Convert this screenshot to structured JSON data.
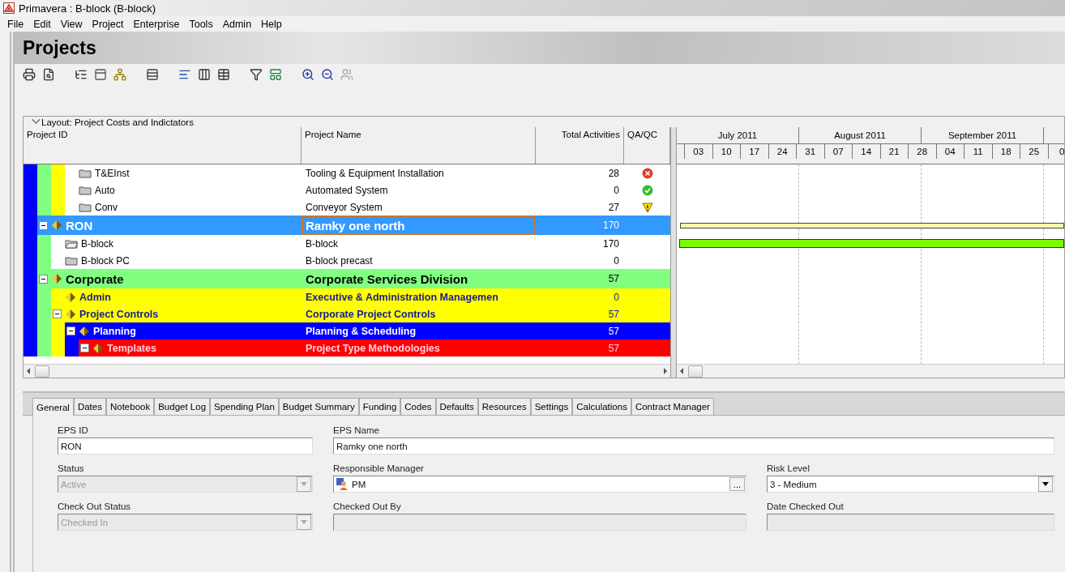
{
  "window": {
    "title": "Primavera : B-block (B-block)"
  },
  "menu": [
    "File",
    "Edit",
    "View",
    "Project",
    "Enterprise",
    "Tools",
    "Admin",
    "Help"
  ],
  "page_title": "Projects",
  "layout": {
    "label": "Layout: Project Costs and Indictators",
    "expanded": true
  },
  "table": {
    "columns": [
      "Project ID",
      "Project Name",
      "Total Activities",
      "QA/QC"
    ],
    "rows": [
      {
        "kind": "project",
        "id": "T&EInst",
        "name": "Tooling & Equipment Installation",
        "total": "28",
        "qaqc": {
          "kind": "error"
        },
        "opened": false,
        "bands": [
          {
            "color": "#0000ff"
          },
          {
            "color": "#80ff80"
          },
          {
            "color": "#ffff00"
          }
        ],
        "selected": false,
        "focused": false
      },
      {
        "kind": "project",
        "id": "Auto",
        "name": "Automated System",
        "total": "0",
        "qaqc": {
          "kind": "ok"
        },
        "opened": false,
        "bands": [
          {
            "color": "#0000ff"
          },
          {
            "color": "#80ff80"
          },
          {
            "color": "#ffff00"
          }
        ],
        "selected": false,
        "focused": false
      },
      {
        "kind": "project",
        "id": "Conv",
        "name": "Conveyor System",
        "total": "27",
        "qaqc": {
          "kind": "warning"
        },
        "opened": false,
        "bands": [
          {
            "color": "#0000ff"
          },
          {
            "color": "#80ff80"
          },
          {
            "color": "#ffff00"
          }
        ],
        "selected": false,
        "focused": false
      },
      {
        "kind": "eps",
        "id": "RON",
        "name": "Ramky one north",
        "total": "170",
        "color": "#80ff80",
        "bands": [
          {
            "color": "#0000ff"
          }
        ],
        "selected": true,
        "focused": true,
        "expanded": true,
        "bar": {
          "kind": "summary"
        },
        "children": [
          {
            "kind": "project",
            "id": "B-block",
            "name": "B-block",
            "total": "170",
            "opened": true,
            "selected": false,
            "focused": false,
            "bar": {
              "kind": "activity"
            }
          },
          {
            "kind": "project",
            "id": "B-block PC",
            "name": "B-block precast",
            "total": "0",
            "opened": false,
            "selected": false,
            "focused": false
          }
        ]
      },
      {
        "kind": "eps",
        "id": "Corporate",
        "name": "Corporate Services Division",
        "total": "57",
        "color": "#80ff80",
        "bands": [
          {
            "color": "#0000ff"
          }
        ],
        "selected": false,
        "focused": false,
        "expanded": true,
        "children": [
          {
            "kind": "eps",
            "id": "Admin",
            "name": "Executive & Administration Managemen",
            "total": "0",
            "color": "#ffff00",
            "selected": false,
            "focused": false
          },
          {
            "kind": "eps",
            "id": "Project Controls",
            "name": "Corporate Project Controls",
            "total": "57",
            "color": "#ffff00",
            "selected": false,
            "focused": false,
            "expanded": true,
            "children": [
              {
                "kind": "eps",
                "id": "Planning",
                "name": "Planning & Scheduling",
                "total": "57",
                "color": "#0000ff",
                "selected": false,
                "focused": false,
                "expanded": true,
                "children": [
                  {
                    "kind": "eps",
                    "id": "Templates",
                    "name": "Project Type Methodologies",
                    "total": "57",
                    "color": "#ff0000",
                    "selected": false,
                    "focused": false,
                    "expanded": true
                  }
                ]
              }
            ]
          }
        ]
      }
    ]
  },
  "gantt": {
    "months": [
      "July 2011",
      "August 2011",
      "September 2011"
    ],
    "weeks": [
      "03",
      "10",
      "17",
      "24",
      "31",
      "07",
      "14",
      "21",
      "28",
      "04",
      "11",
      "18",
      "25",
      "0"
    ]
  },
  "tabs": [
    {
      "label": "General",
      "selected": true
    },
    {
      "label": "Dates",
      "selected": false
    },
    {
      "label": "Notebook",
      "selected": false
    },
    {
      "label": "Budget Log",
      "selected": false
    },
    {
      "label": "Spending Plan",
      "selected": false
    },
    {
      "label": "Budget Summary",
      "selected": false
    },
    {
      "label": "Funding",
      "selected": false
    },
    {
      "label": "Codes",
      "selected": false
    },
    {
      "label": "Defaults",
      "selected": false
    },
    {
      "label": "Resources",
      "selected": false
    },
    {
      "label": "Settings",
      "selected": false
    },
    {
      "label": "Calculations",
      "selected": false
    },
    {
      "label": "Contract Manager",
      "selected": false
    }
  ],
  "form_rows": [
    [
      {
        "label": "EPS ID",
        "value": "RON",
        "kind": "text",
        "disabled": false
      },
      {
        "label": "EPS Name",
        "value": "Ramky one north",
        "kind": "text",
        "disabled": false
      }
    ],
    [
      {
        "label": "Status",
        "value": "Active",
        "kind": "select",
        "disabled": true
      },
      {
        "label": "Responsible Manager",
        "value": "PM",
        "kind": "lookup",
        "button": "...",
        "disabled": false
      },
      {
        "label": "Risk Level",
        "value": "3 - Medium",
        "kind": "select",
        "disabled": false
      }
    ],
    [
      {
        "label": "Check Out Status",
        "value": "Checked In",
        "kind": "select",
        "disabled": true
      },
      {
        "label": "Checked Out By",
        "kind": "text",
        "disabled": true
      },
      {
        "label": "Date Checked Out",
        "kind": "text",
        "disabled": true
      }
    ]
  ]
}
